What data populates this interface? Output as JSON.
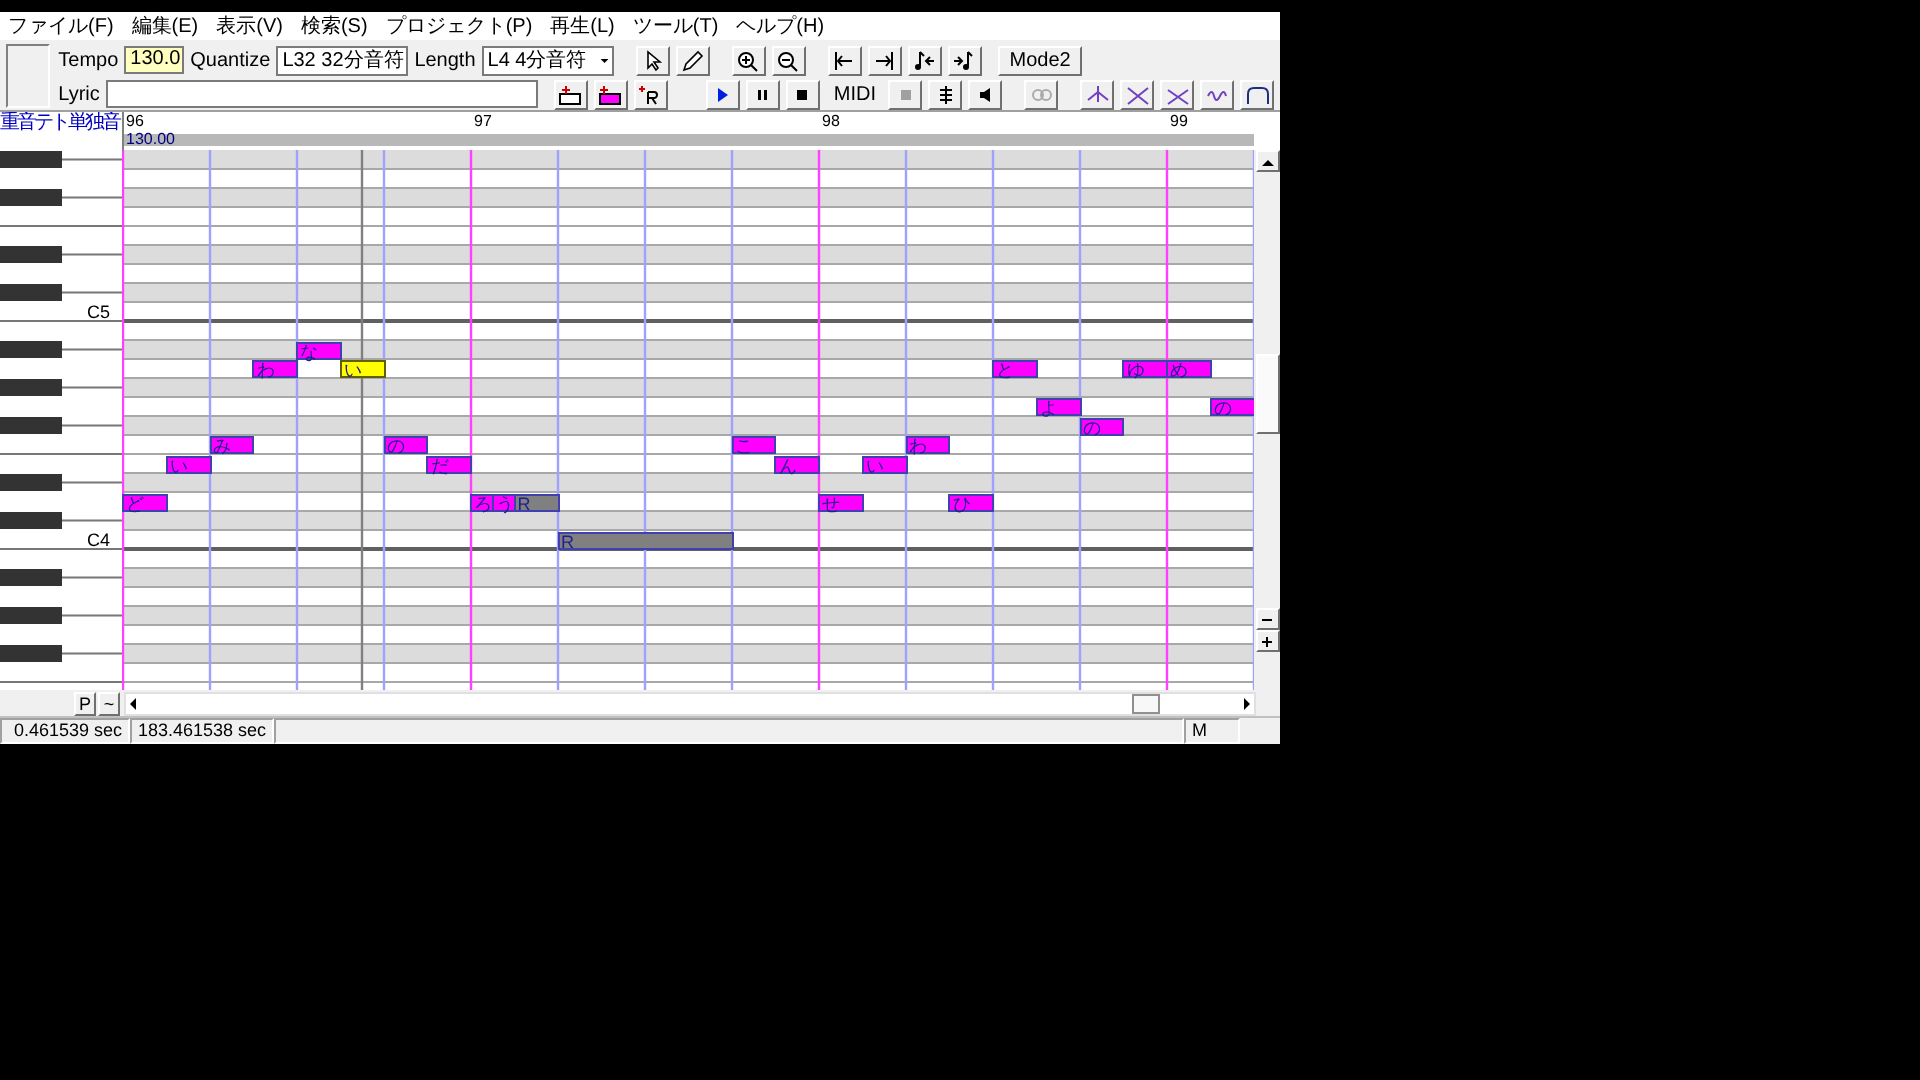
{
  "menu": [
    "ファイル(F)",
    "編集(E)",
    "表示(V)",
    "検索(S)",
    "プロジェクト(P)",
    "再生(L)",
    "ツール(T)",
    "ヘルプ(H)"
  ],
  "toolbar": {
    "tempo_label": "Tempo",
    "tempo": "130.0",
    "quantize_label": "Quantize",
    "quantize": "L32 32分音符",
    "length_label": "Length",
    "length": "L4 4分音符",
    "lyric_label": "Lyric",
    "mode_button": "Mode2",
    "midi_label": "MIDI"
  },
  "ruler": {
    "track_name": "重音テト単独音",
    "measures": [
      "96",
      "97",
      "98",
      "99"
    ],
    "tempo_marker": "130.00"
  },
  "piano": {
    "labels": [
      "C5",
      "C4"
    ]
  },
  "notes": [
    {
      "kind": "note",
      "lyric": "ど",
      "selected": false
    },
    {
      "kind": "note",
      "lyric": "い",
      "selected": false
    },
    {
      "kind": "note",
      "lyric": "み",
      "selected": false
    },
    {
      "kind": "note",
      "lyric": "わ",
      "selected": false
    },
    {
      "kind": "note",
      "lyric": "な",
      "selected": false
    },
    {
      "kind": "note",
      "lyric": "い",
      "selected": true
    },
    {
      "kind": "note",
      "lyric": "の",
      "selected": false
    },
    {
      "kind": "note",
      "lyric": "だ",
      "selected": false
    },
    {
      "kind": "note",
      "lyric": "ろ",
      "selected": false
    },
    {
      "kind": "note",
      "lyric": "う",
      "selected": false
    },
    {
      "kind": "rest",
      "lyric": "R",
      "selected": false
    },
    {
      "kind": "rest",
      "lyric": "R",
      "selected": false
    },
    {
      "kind": "note",
      "lyric": "こ",
      "selected": false
    },
    {
      "kind": "note",
      "lyric": "ん",
      "selected": false
    },
    {
      "kind": "note",
      "lyric": "せ",
      "selected": false
    },
    {
      "kind": "note",
      "lyric": "い",
      "selected": false
    },
    {
      "kind": "note",
      "lyric": "わ",
      "selected": false
    },
    {
      "kind": "note",
      "lyric": "ひ",
      "selected": false
    },
    {
      "kind": "note",
      "lyric": "と",
      "selected": false
    },
    {
      "kind": "note",
      "lyric": "よ",
      "selected": false
    },
    {
      "kind": "note",
      "lyric": "の",
      "selected": false
    },
    {
      "kind": "note",
      "lyric": "ゆ",
      "selected": false
    },
    {
      "kind": "note",
      "lyric": "め",
      "selected": false
    },
    {
      "kind": "note",
      "lyric": "の",
      "selected": false
    }
  ],
  "bottom": {
    "buttons": [
      "P",
      "~"
    ]
  },
  "status_bar": [
    "0.461539 sec",
    "183.461538 sec",
    "M"
  ]
}
